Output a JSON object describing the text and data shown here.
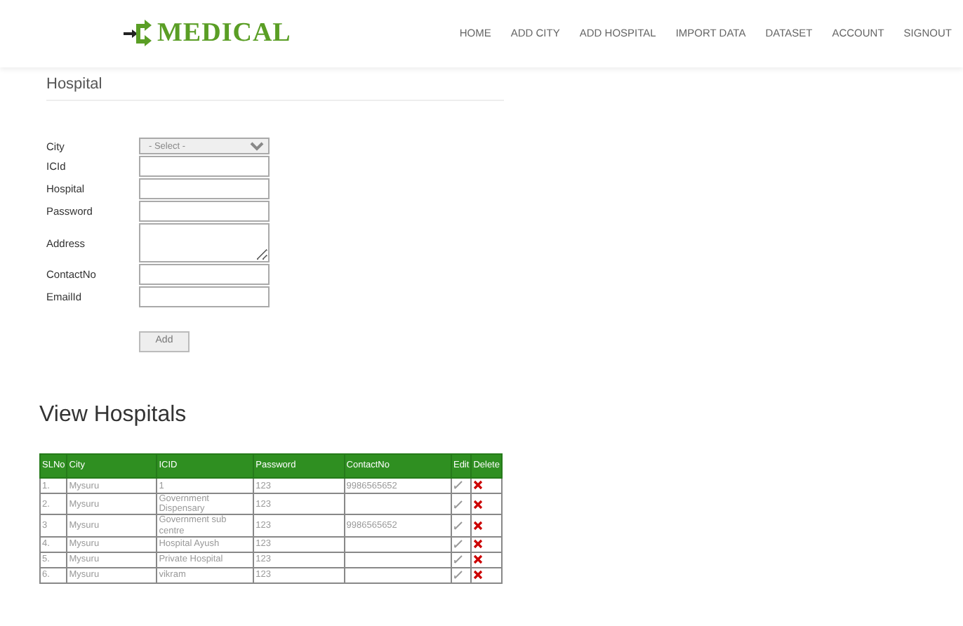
{
  "brand": "MEDICAL",
  "nav": [
    {
      "label": "HOME"
    },
    {
      "label": "ADD CITY"
    },
    {
      "label": "ADD HOSPITAL"
    },
    {
      "label": "IMPORT DATA"
    },
    {
      "label": "DATASET"
    },
    {
      "label": "ACCOUNT"
    },
    {
      "label": "SIGNOUT"
    }
  ],
  "form": {
    "title": "Hospital",
    "fields": [
      {
        "label": "City",
        "kind": "select",
        "value": "- Select -"
      },
      {
        "label": "ICId",
        "kind": "text"
      },
      {
        "label": "Hospital",
        "kind": "text"
      },
      {
        "label": "Password",
        "kind": "text"
      },
      {
        "label": "Address",
        "kind": "textarea"
      },
      {
        "label": "ContactNo",
        "kind": "text"
      },
      {
        "label": "EmailId",
        "kind": "text"
      }
    ],
    "submit": "Add"
  },
  "table": {
    "title": "View Hospitals",
    "columns": [
      "SLNo",
      "City",
      "ICID",
      "Password",
      "ContactNo",
      "Edit",
      "Delete"
    ],
    "rows": [
      {
        "slno": "1.",
        "city": "Mysuru",
        "icid": "1",
        "password": "123",
        "contact": "9986565652"
      },
      {
        "slno": "2.",
        "city": "Mysuru",
        "icid": "Government Dispensary",
        "password": "123",
        "contact": ""
      },
      {
        "slno": "3",
        "city": "Mysuru",
        "icid": "Government sub centre",
        "password": "123",
        "contact": "9986565652"
      },
      {
        "slno": "4.",
        "city": "Mysuru",
        "icid": "Hospital Ayush",
        "password": "123",
        "contact": ""
      },
      {
        "slno": "5.",
        "city": "Mysuru",
        "icid": "Private Hospital",
        "password": "123",
        "contact": ""
      },
      {
        "slno": "6.",
        "city": "Mysuru",
        "icid": "vikram",
        "password": "123",
        "contact": ""
      }
    ]
  }
}
